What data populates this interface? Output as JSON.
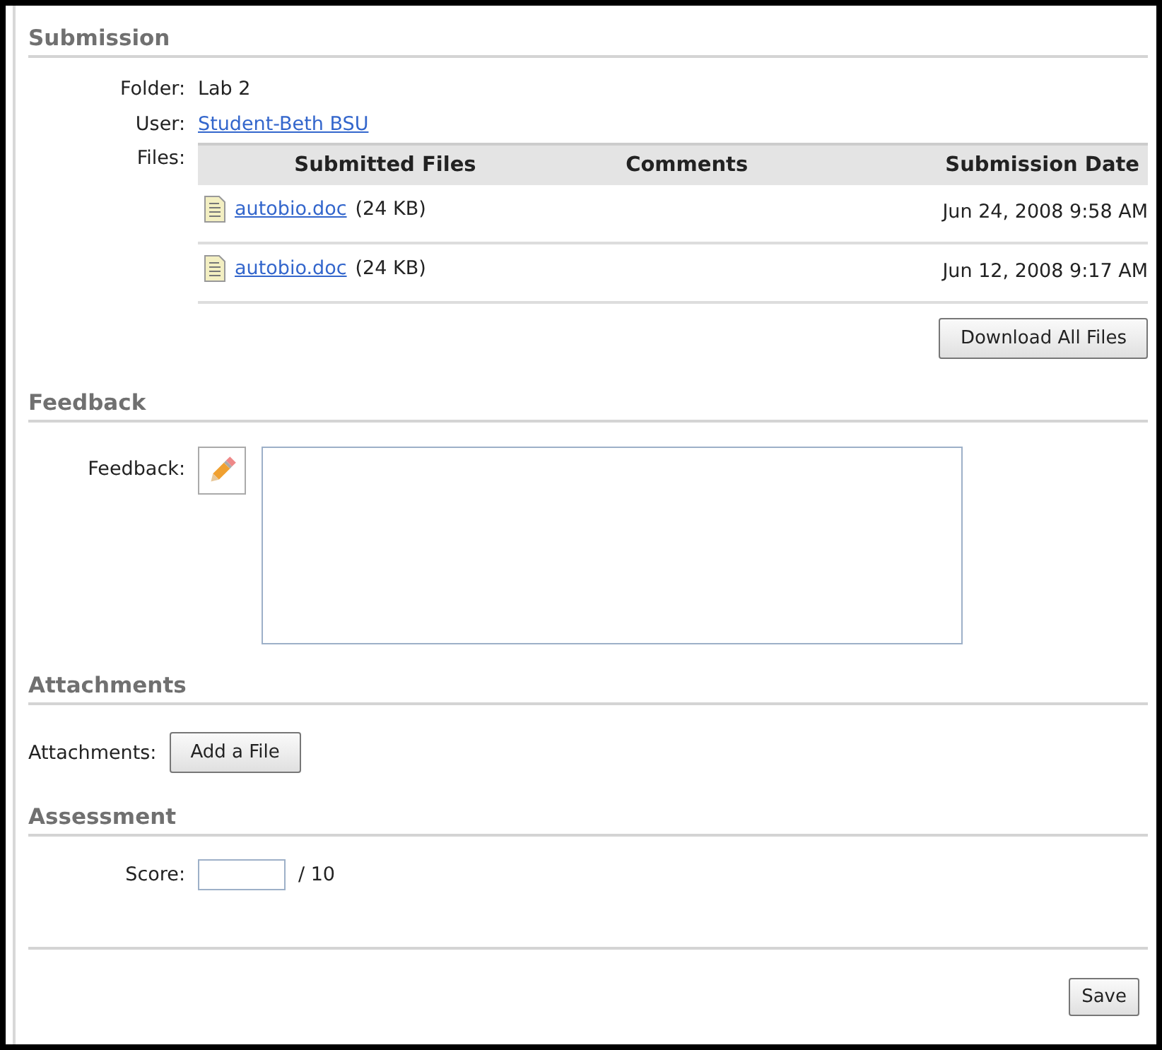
{
  "sections": [
    {
      "kind": "submission",
      "heading": "Submission",
      "folder": {
        "label": "Folder:",
        "value": "Lab 2"
      },
      "user": {
        "label": "User:",
        "value": "Student-Beth BSU"
      },
      "files_label": "Files:",
      "table": {
        "columns": [
          "Submitted Files",
          "Comments",
          "Submission Date"
        ],
        "rows": [
          {
            "file": "autobio.doc",
            "size": "(24 KB)",
            "comments": "",
            "date": "Jun 24, 2008 9:58 AM"
          },
          {
            "file": "autobio.doc",
            "size": "(24 KB)",
            "comments": "",
            "date": "Jun 12, 2008 9:17 AM"
          }
        ]
      },
      "button": "Download All Files"
    },
    {
      "kind": "feedback",
      "heading": "Feedback",
      "label": "Feedback:"
    },
    {
      "kind": "attachments",
      "heading": "Attachments",
      "label": "Attachments:",
      "button": "Add a File"
    },
    {
      "kind": "assessment",
      "heading": "Assessment",
      "label": "Score:",
      "out_of": "/ 10"
    }
  ],
  "save_button": "Save"
}
